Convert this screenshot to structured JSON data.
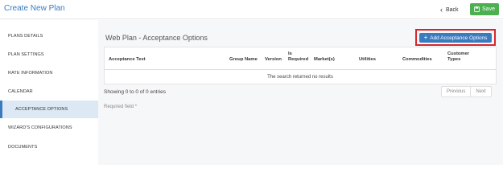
{
  "header": {
    "title": "Create New Plan",
    "back_label": "Back",
    "save_label": "Save",
    "save_color": "#4caf50"
  },
  "sidebar": {
    "items": [
      {
        "label": "PLANS DETAILS"
      },
      {
        "label": "PLAN SETTINGS"
      },
      {
        "label": "RATE INFORMATION"
      },
      {
        "label": "CALENDAR"
      },
      {
        "label": "ACCEPTANCE OPTIONS",
        "active": true
      },
      {
        "label": "WIZARD'S CONFIGURATIONS"
      },
      {
        "label": "DOCUMENTS"
      }
    ]
  },
  "main": {
    "section_title": "Web Plan - Acceptance Options",
    "add_button_label": "Add Acceptance Options",
    "table": {
      "columns": [
        {
          "line1": "",
          "line2": "Acceptance Text"
        },
        {
          "line1": "",
          "line2": "Group Name"
        },
        {
          "line1": "",
          "line2": "Version"
        },
        {
          "line1": "Is",
          "line2": "Required"
        },
        {
          "line1": "",
          "line2": "Market(s)"
        },
        {
          "line1": "",
          "line2": "Utilities"
        },
        {
          "line1": "",
          "line2": "Commodities"
        },
        {
          "line1": "Customer",
          "line2": "Types"
        }
      ],
      "empty_message": "The search returned no results"
    },
    "entries_info": "Showing 0 to 0 of 0 entries",
    "pager": {
      "previous": "Previous",
      "next": "Next"
    },
    "required_note": "Required field *"
  },
  "colors": {
    "accent": "#3a7bbf",
    "highlight_border": "#d9262b",
    "active_item_bg": "#dce8f3"
  }
}
